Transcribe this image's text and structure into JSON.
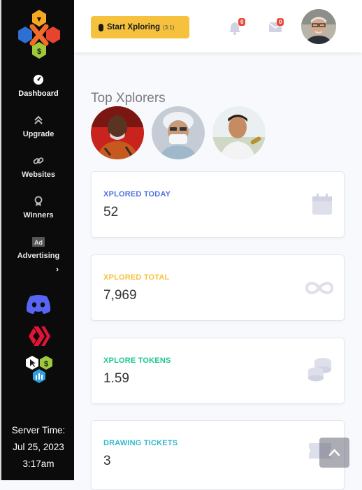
{
  "sidebar": {
    "nav": [
      {
        "label": "Dashboard",
        "icon": "gauge-icon"
      },
      {
        "label": "Upgrade",
        "icon": "double-chevron-up-icon"
      },
      {
        "label": "Websites",
        "icon": "link-icon"
      },
      {
        "label": "Winners",
        "icon": "award-icon"
      },
      {
        "label": "Advertising",
        "icon": "ad-icon"
      }
    ],
    "server_time_label": "Server Time:",
    "server_date": "Jul 25, 2023",
    "server_clock": "3:17am",
    "social": [
      "discord-icon",
      "hive-icon",
      "xplorer-hex-icon"
    ]
  },
  "topbar": {
    "start_label": "Start Xploring",
    "start_sub": "(3:1)",
    "bell_count": "0",
    "mail_count": "0"
  },
  "main": {
    "section_title": "Top Xplorers",
    "cards": [
      {
        "label": "XPLORED TODAY",
        "value": "52",
        "color": "#4e73df",
        "icon": "calendar-icon"
      },
      {
        "label": "XPLORED TOTAL",
        "value": "7,969",
        "color": "#f6c23e",
        "icon": "infinity-icon"
      },
      {
        "label": "XPLORE TOKENS",
        "value": "1.59",
        "color": "#1cc88a",
        "icon": "coins-icon"
      },
      {
        "label": "DRAWING TICKETS",
        "value": "3",
        "color": "#36b9cc",
        "icon": "ticket-icon"
      }
    ]
  },
  "colors": {
    "sidebar_bg": "#0b0b0c",
    "accent_yellow": "#f6c23e",
    "badge_red": "#e74a3b"
  }
}
